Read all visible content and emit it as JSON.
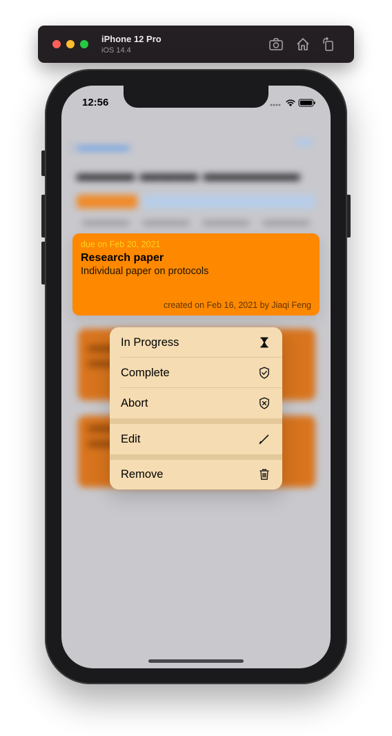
{
  "simulator": {
    "device_name": "iPhone 12 Pro",
    "os_version": "iOS 14.4",
    "icons": [
      "screenshot-icon",
      "home-icon",
      "rotate-icon"
    ]
  },
  "status_bar": {
    "time": "12:56"
  },
  "card": {
    "due": "due on Feb 20, 2021",
    "title": "Research paper",
    "description": "Individual paper on protocols",
    "created": "created on Feb 16, 2021 by Jiaqi Feng",
    "background_color": "#fe8800"
  },
  "context_menu": {
    "items": [
      {
        "label": "In Progress",
        "icon": "hourglass-icon"
      },
      {
        "label": "Complete",
        "icon": "shield-check-icon"
      },
      {
        "label": "Abort",
        "icon": "shield-x-icon"
      },
      {
        "label": "Edit",
        "icon": "pencil-icon"
      },
      {
        "label": "Remove",
        "icon": "trash-icon"
      }
    ],
    "background_color": "#f5dcb2"
  }
}
